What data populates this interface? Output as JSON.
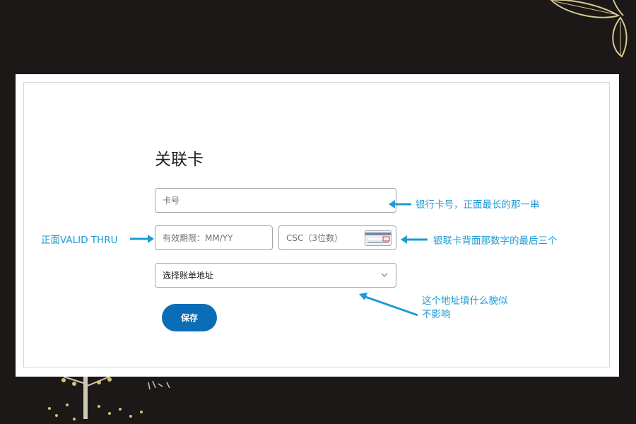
{
  "form": {
    "title": "关联卡",
    "card_number_placeholder": "卡号",
    "expiry_placeholder": "有效期限：MM/YY",
    "csc_placeholder": "CSC（3位数）",
    "billing_address_label": "选择账单地址",
    "save_label": "保存"
  },
  "annotations": {
    "card_number": "银行卡号，正面最长的那一串",
    "expiry": "正面VALID THRU",
    "csc": "银联卡背面那数字的最后三个",
    "address_line1": "这个地址填什么貌似",
    "address_line2": "不影响"
  },
  "colors": {
    "background": "#1b1817",
    "accent_button": "#0a6db6",
    "annotation": "#1e9ad6"
  },
  "icons": [
    "card-back-icon",
    "chevron-down-icon",
    "arrow-left-icon",
    "arrow-right-icon",
    "leaf-decoration-icon",
    "tree-decoration-icon"
  ]
}
